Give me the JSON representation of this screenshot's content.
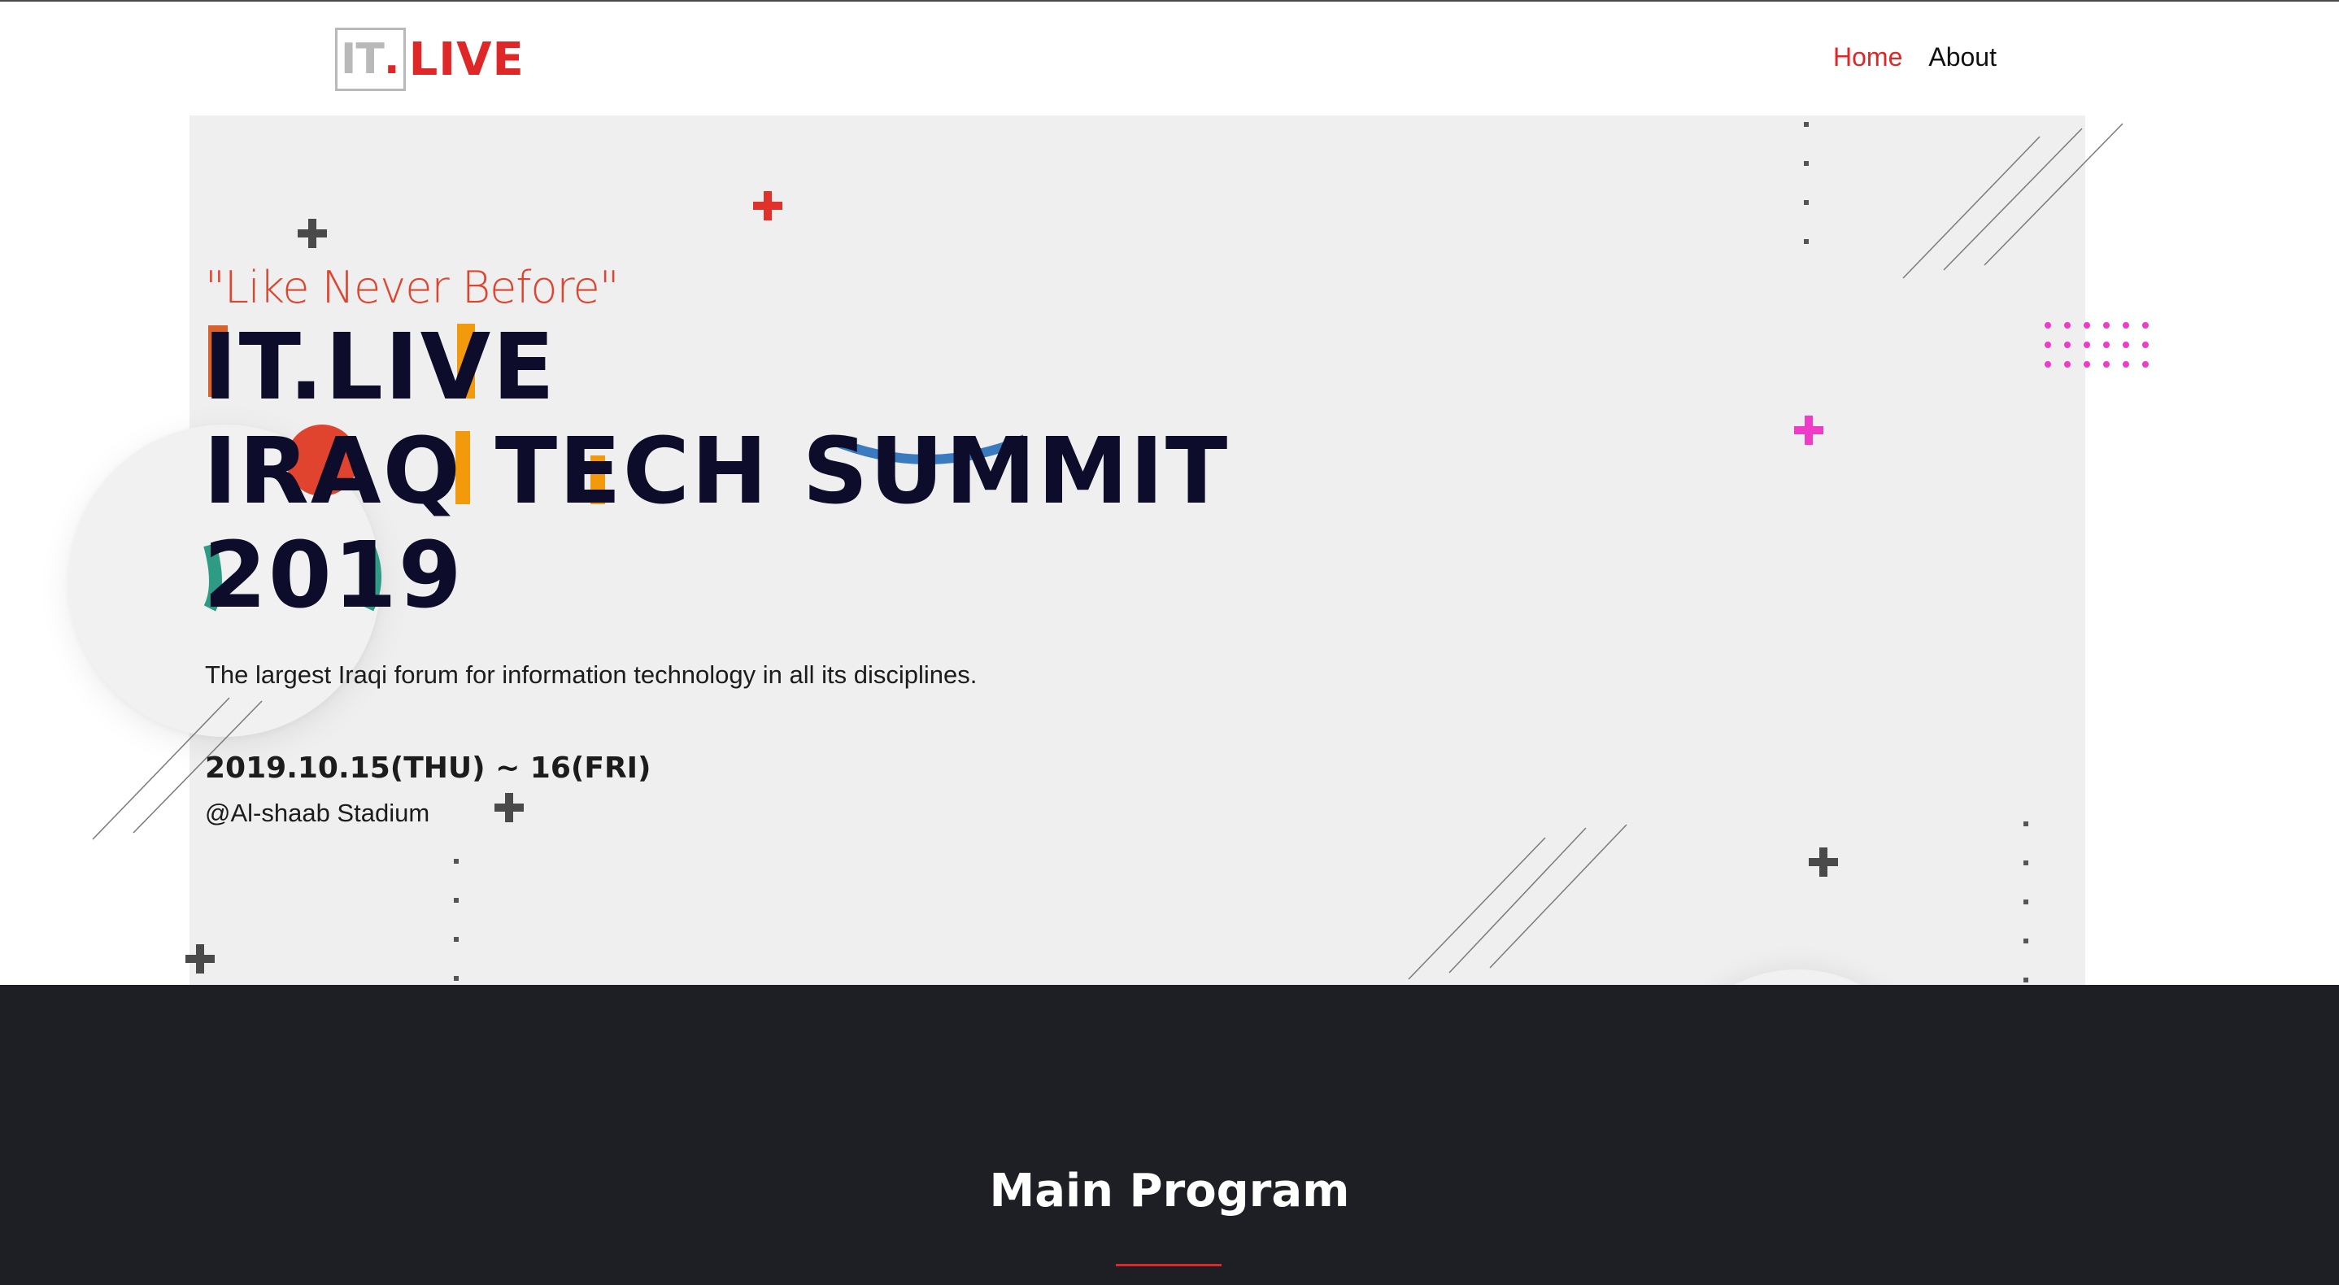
{
  "header": {
    "logo": {
      "it": "IT",
      "dot": ".",
      "live": "LIVE"
    },
    "nav": [
      {
        "label": "Home",
        "active": true
      },
      {
        "label": "About",
        "active": false
      }
    ]
  },
  "hero": {
    "tagline": "\"Like Never Before\"",
    "title_lines": [
      "IT.LIVE",
      "IRAQ TECH SUMMIT",
      "2019"
    ],
    "description": "The largest Iraqi forum for information technology in all its disciplines.",
    "date": "2019.10.15(THU) ~ 16(FRI)",
    "venue": "@Al-shaab Stadium"
  },
  "section": {
    "title": "Main Program"
  },
  "colors": {
    "accent": "#e02727",
    "navy": "#0d0d2b",
    "hero_bg": "#efefef",
    "dark_bg": "#1e1f24",
    "magenta": "#f03ac8",
    "orange": "#f29a0b",
    "teal": "#2e9c84",
    "blue": "#3a7bbf",
    "rust": "#d9612b"
  },
  "icons": [
    "plus-icon",
    "dot-grid-icon",
    "diagonal-lines-icon"
  ]
}
